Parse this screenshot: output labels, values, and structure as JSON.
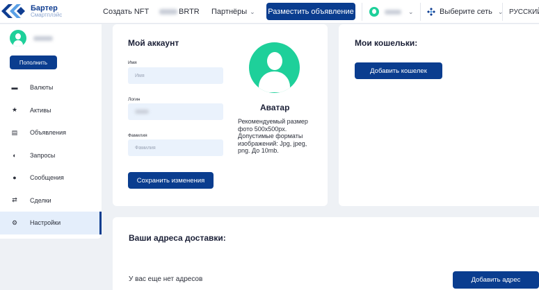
{
  "brand": {
    "title": "Бартер",
    "subtitle": "Смартплэйс",
    "logo_color": "#0f3d91"
  },
  "header": {
    "create_nft": "Создать NFT",
    "balance_currency": "BRTR",
    "partners": "Партнёры",
    "post_ad": "Разместить объявление",
    "select_network": "Выберите сеть",
    "language": "РУССКИЙ",
    "icons": [
      "chevron-down-icon",
      "network-icon",
      "avatar"
    ]
  },
  "sidebar": {
    "topup": "Пополнить",
    "items": [
      {
        "label": "Валюты",
        "icon": "wallet-icon"
      },
      {
        "label": "Активы",
        "icon": "star-icon"
      },
      {
        "label": "Объявления",
        "icon": "ad-icon"
      },
      {
        "label": "Запросы",
        "icon": "request-icon"
      },
      {
        "label": "Сообщения",
        "icon": "chat-icon"
      },
      {
        "label": "Сделки",
        "icon": "handshake-icon"
      },
      {
        "label": "Настройки",
        "icon": "gear-icon",
        "active": true
      }
    ]
  },
  "account": {
    "title": "Мой аккаунт",
    "name_label": "Имя",
    "name_placeholder": "Имя",
    "login_label": "Логин",
    "surname_label": "Фамилия",
    "surname_placeholder": "Фамилия",
    "save": "Сохранить изменения",
    "avatar_title": "Аватар",
    "avatar_desc": "Рекомендуемый размер фото 500x500px. Допустимые форматы изображений: Jpg, jpeg, png. До 10mb."
  },
  "wallets": {
    "title": "Мои кошельки:",
    "add": "Добавить кошелек"
  },
  "delivery": {
    "title": "Ваши адреса доставки:",
    "empty": "У вас еще нет адресов",
    "add": "Добавить адрес"
  },
  "colors": {
    "primary": "#0a3d8f",
    "avatar": "#1ed09a",
    "field_bg": "#eaf2fc",
    "page_bg": "#eef1f5"
  }
}
